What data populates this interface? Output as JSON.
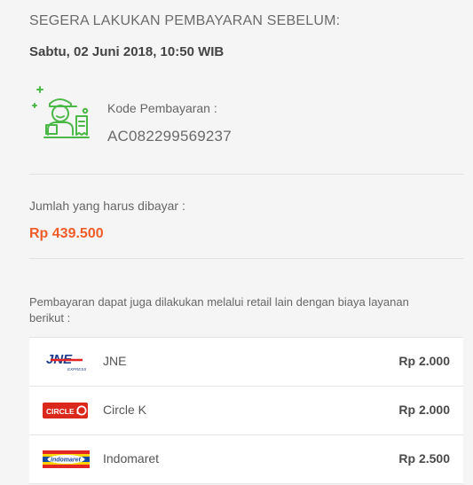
{
  "deadline": {
    "label": "SEGERA LAKUKAN PEMBAYARAN SEBELUM:",
    "value": "Sabtu, 02 Juni 2018, 10:50 WIB"
  },
  "payment_code": {
    "icon": "courier-payment-icon",
    "label": "Kode Pembayaran :",
    "value": "AC082299569237"
  },
  "amount": {
    "label": "Jumlah yang harus dibayar :",
    "value": "Rp 439.500",
    "color": "#ee5d2a"
  },
  "retail": {
    "note": "Pembayaran dapat juga dilakukan melalui retail lain dengan biaya layanan berikut :",
    "items": [
      {
        "name": "JNE",
        "fee": "Rp 2.000",
        "logo": "jne-logo",
        "logo_text": "JNE",
        "logo_subtext": "EXPRESS"
      },
      {
        "name": "Circle K",
        "fee": "Rp 2.000",
        "logo": "circle-k-logo",
        "logo_text": "CIRCLE K"
      },
      {
        "name": "Indomaret",
        "fee": "Rp 2.500",
        "logo": "indomaret-logo",
        "logo_text": "Indomaret"
      }
    ]
  },
  "colors": {
    "background": "#f5f5f5",
    "icon_green": "#4cb848",
    "jne_blue": "#1e3f8f",
    "jne_red": "#e32524",
    "circlek_red": "#da291c",
    "indomaret_blue": "#1a4aa0",
    "indomaret_yellow": "#ffd200"
  }
}
